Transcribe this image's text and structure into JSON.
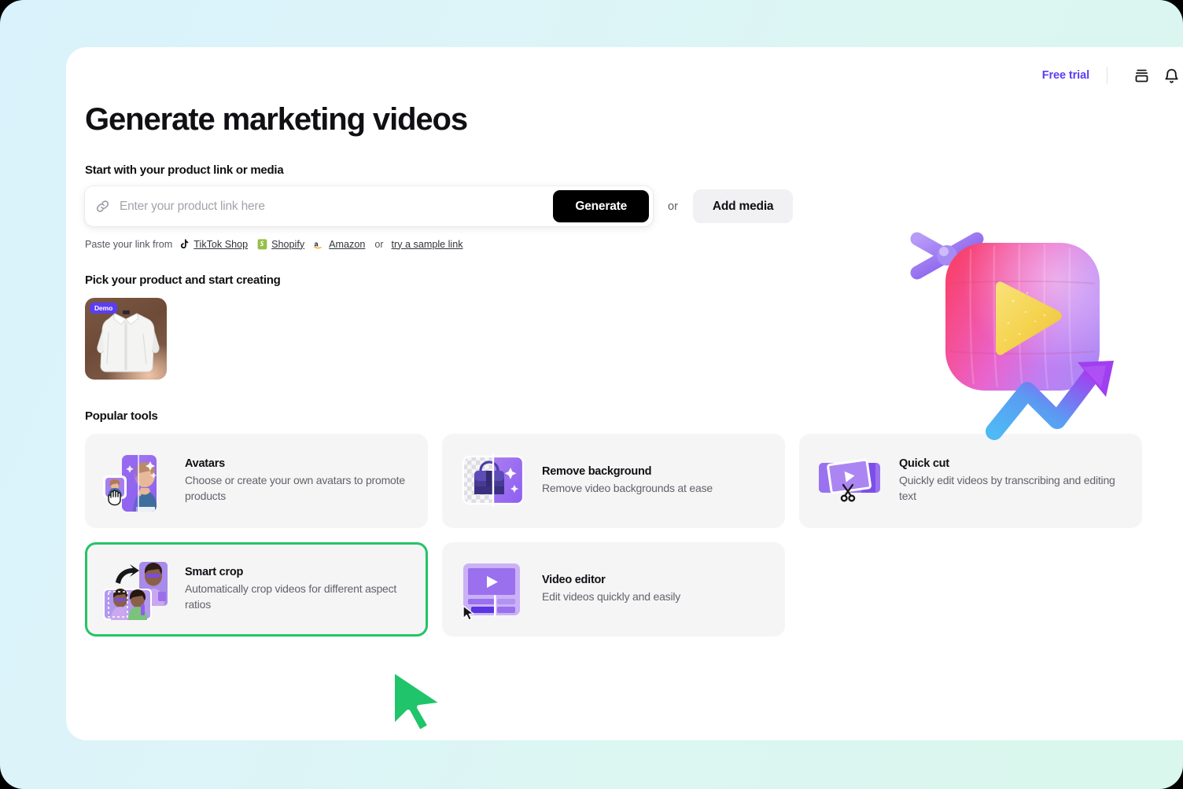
{
  "header": {
    "free_trial_label": "Free trial",
    "icons": [
      {
        "name": "inbox-icon"
      },
      {
        "name": "bell-icon"
      }
    ]
  },
  "main": {
    "page_title": "Generate marketing videos",
    "start_section_label": "Start with your product link or media",
    "search": {
      "placeholder": "Enter your product link here",
      "value": "",
      "link_icon": "link-icon"
    },
    "generate_label": "Generate",
    "or_label": "or",
    "add_media_label": "Add media",
    "paste_row": {
      "lead": "Paste your link from",
      "brands": [
        {
          "name": "TikTok Shop",
          "icon": "tiktok-icon"
        },
        {
          "name": "Shopify",
          "icon": "shopify-icon"
        },
        {
          "name": "Amazon",
          "icon": "amazon-icon"
        }
      ],
      "mid": "or",
      "sample_link": "try a sample link"
    },
    "product_section_label": "Pick your product and start creating",
    "product": {
      "badge": "Demo",
      "alt": "white dress shirt"
    },
    "tools_section_label": "Popular tools",
    "tools": [
      {
        "id": "avatars",
        "title": "Avatars",
        "desc": "Choose or create your own avatars to promote products",
        "highlighted": false
      },
      {
        "id": "remove-background",
        "title": "Remove background",
        "desc": "Remove video backgrounds at ease",
        "highlighted": false
      },
      {
        "id": "quick-cut",
        "title": "Quick cut",
        "desc": "Quickly edit videos by transcribing and editing text",
        "highlighted": false
      },
      {
        "id": "smart-crop",
        "title": "Smart crop",
        "desc": "Automatically crop videos for different aspect ratios",
        "highlighted": true
      },
      {
        "id": "video-editor",
        "title": "Video editor",
        "desc": "Edit videos quickly and easily",
        "highlighted": false
      }
    ]
  },
  "colors": {
    "accent_purple": "#5b3df5",
    "highlight_green": "#24c468",
    "cursor_green": "#20c46a",
    "button_black": "#000000",
    "card_gray": "#f5f5f6",
    "backdrop_left": "#d9f2fb",
    "backdrop_right": "#d9f7ec"
  }
}
